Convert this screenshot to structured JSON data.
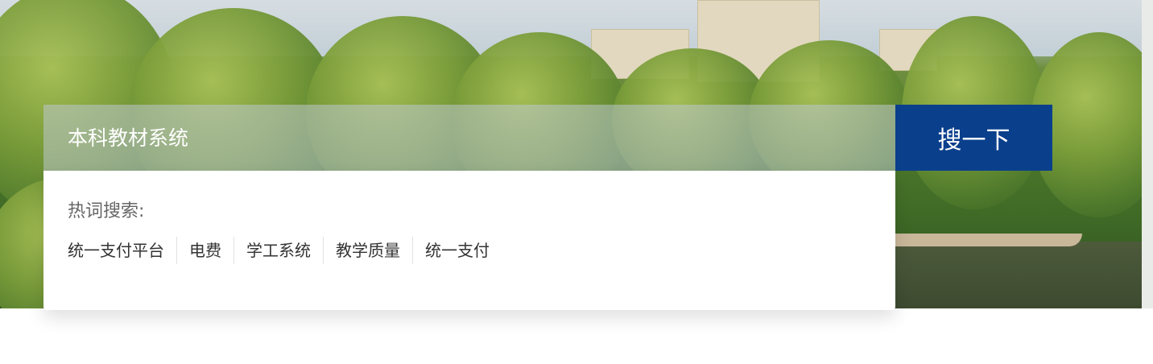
{
  "search": {
    "placeholder": "本科教材系统",
    "button_label": "搜一下"
  },
  "hot_words": {
    "title": "热词搜索:",
    "items": [
      "统一支付平台",
      "电费",
      "学工系统",
      "教学质量",
      "统一支付"
    ]
  },
  "colors": {
    "button_bg": "#0a3f8c",
    "panel_bg": "#ffffff",
    "hot_title": "#666666",
    "hot_item": "#333333"
  }
}
